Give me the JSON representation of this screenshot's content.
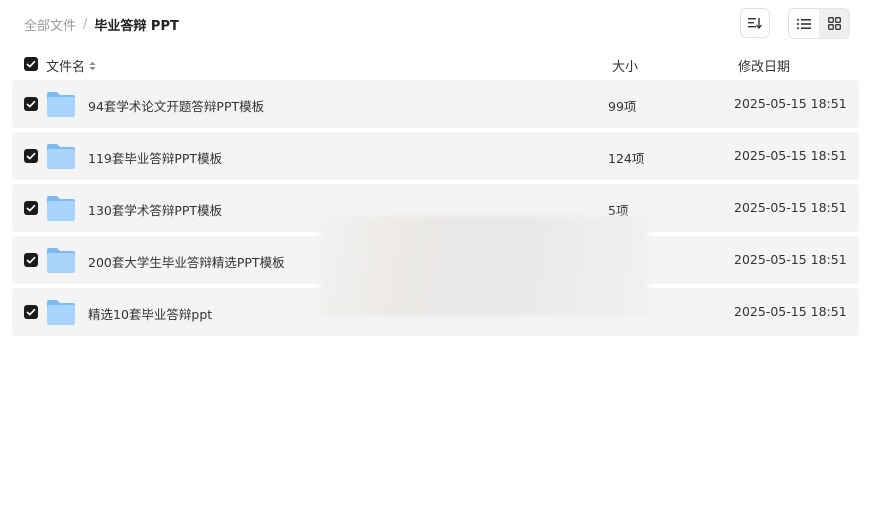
{
  "breadcrumb": {
    "root": "全部文件",
    "separator": "/",
    "current": "毕业答辩 PPT"
  },
  "toolbar": {
    "sort_icon": "sort-icon",
    "list_view_icon": "list-view-icon",
    "grid_view_icon": "grid-view-icon",
    "active_view": "list"
  },
  "columns": {
    "name": "文件名",
    "size": "大小",
    "date": "修改日期"
  },
  "files": [
    {
      "name": "94套学术论文开题答辩PPT模板",
      "size": "99项",
      "date": "2025-05-15 18:51",
      "checked": true
    },
    {
      "name": "119套毕业答辩PPT模板",
      "size": "124项",
      "date": "2025-05-15 18:51",
      "checked": true
    },
    {
      "name": "130套学术答辩PPT模板",
      "size": "5项",
      "date": "2025-05-15 18:51",
      "checked": true
    },
    {
      "name": "200套大学生毕业答辩精选PPT模板",
      "size": "",
      "date": "2025-05-15 18:51",
      "checked": true
    },
    {
      "name": "精选10套毕业答辩ppt",
      "size": "",
      "date": "2025-05-15 18:51",
      "checked": true
    }
  ],
  "colors": {
    "row_background": "#f4f4f4",
    "checkbox": "#1a1a1a",
    "folder_light": "#a9d4fb",
    "folder_dark": "#7cbaf3"
  }
}
